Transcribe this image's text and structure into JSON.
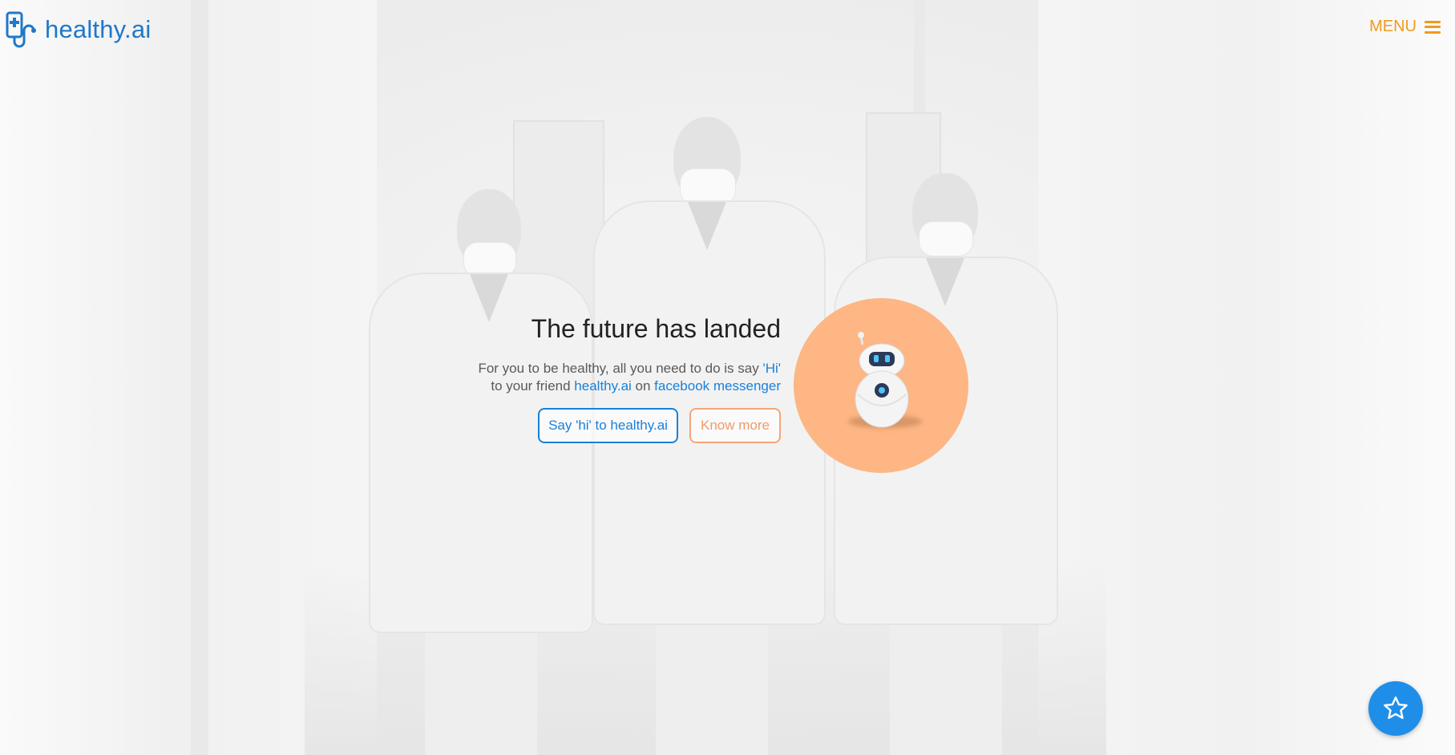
{
  "brand": {
    "name": "healthy.ai",
    "icon": "phone-stethoscope-logo-icon",
    "color": "#1f78c8"
  },
  "nav": {
    "menu_label": "MENU",
    "menu_icon": "hamburger-icon",
    "accent": "#ef9b1c"
  },
  "hero": {
    "title": "The future has landed",
    "line1_prefix": "For you to be healthy, all you need to do is say ",
    "line1_link": "'Hi'",
    "line2_prefix": "to your friend ",
    "line2_link1": "healthy.ai",
    "line2_mid": " on ",
    "line2_link2": "facebook messenger",
    "primary_button": "Say 'hi' to healthy.ai",
    "secondary_button": "Know more",
    "link_color": "#1a80d9",
    "secondary_color": "#f19b6a"
  },
  "bot": {
    "icon": "robot-mascot-icon",
    "circle_color": "#fdb684"
  },
  "fab": {
    "icon": "star-icon",
    "color": "#1f8ee9"
  }
}
